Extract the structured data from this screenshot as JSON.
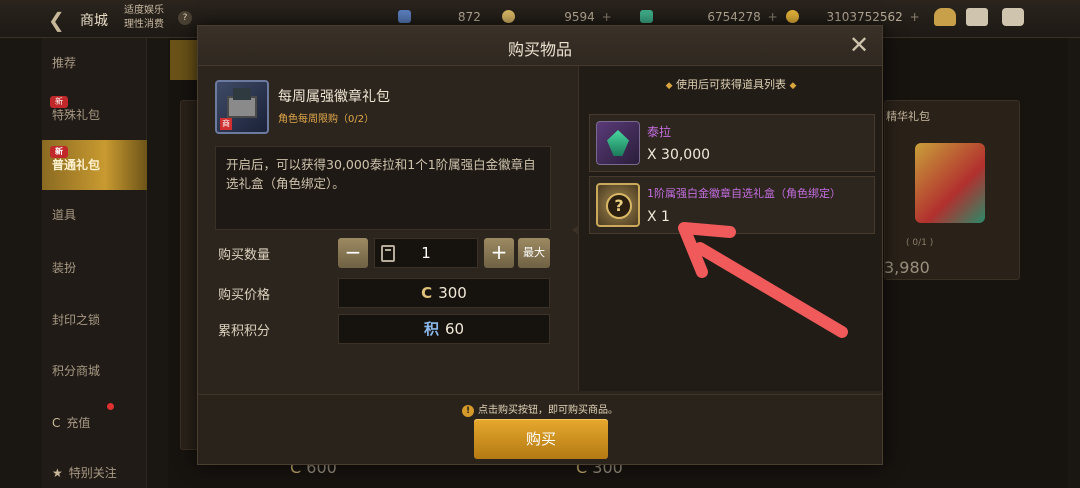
{
  "topbar": {
    "back_icon": "back-arrow-icon",
    "title": "商城",
    "slogan_line1": "适度娱乐",
    "slogan_line2": "理性消费",
    "slogan_help": "?",
    "currencies": [
      {
        "icon": "ticket-icon",
        "value": "872",
        "color": "#5a7fbf"
      },
      {
        "icon": "coin-icon",
        "value": "9594",
        "color": "#d9b866"
      },
      {
        "icon": "gem-icon",
        "value": "6754278",
        "color": "#3fae8a"
      },
      {
        "icon": "gold-icon",
        "value": "3103752562",
        "color": "#e6b33a"
      }
    ],
    "plus_label": "+"
  },
  "sidebar": {
    "items": [
      {
        "label": "推荐",
        "badge": ""
      },
      {
        "label": "特殊礼包",
        "badge": "新"
      },
      {
        "label": "普通礼包",
        "badge": "新"
      },
      {
        "label": "道具",
        "badge": ""
      },
      {
        "label": "装扮",
        "badge": ""
      },
      {
        "label": "封印之锁",
        "badge": ""
      },
      {
        "label": "积分商城",
        "badge": ""
      },
      {
        "label": "充值",
        "badge": ""
      },
      {
        "label": "特别关注",
        "badge": ""
      }
    ]
  },
  "background": {
    "card_label": "精华礼包",
    "card_limit": "( 0/1 )",
    "card_price": "3,980",
    "price_left": "600",
    "price_mid": "300"
  },
  "modal": {
    "title": "购买物品",
    "close_label": "✕",
    "item": {
      "name": "每周属强徽章礼包",
      "limit": "角色每周限购（0/2）",
      "tag": "商"
    },
    "description": "开启后，可以获得30,000泰拉和1个1阶属强白金徽章自选礼盒（角色绑定）。",
    "quantity": {
      "label": "购买数量",
      "minus": "−",
      "value": "1",
      "plus": "+",
      "max": "最大"
    },
    "price": {
      "label": "购买价格",
      "icon": "C",
      "value": "300"
    },
    "points": {
      "label": "累积积分",
      "icon": "积",
      "value": "60"
    },
    "rewards_title": "使用后可获得道具列表",
    "rewards_diamond": "◆",
    "rewards": [
      {
        "name": "泰拉",
        "qty": "X 30,000",
        "name_color": "#c46ee0",
        "icon": "tera-chest-icon"
      },
      {
        "name": "1阶属强白金徽章自选礼盒（角色绑定）",
        "qty": "X 1",
        "name_color": "#c46ee0",
        "icon": "mystery-box-icon"
      }
    ],
    "tip_icon": "!",
    "tip": "点击购买按钮，即可购买商品。",
    "buy_label": "购买"
  },
  "annotation": {
    "color": "#f05a5a"
  }
}
